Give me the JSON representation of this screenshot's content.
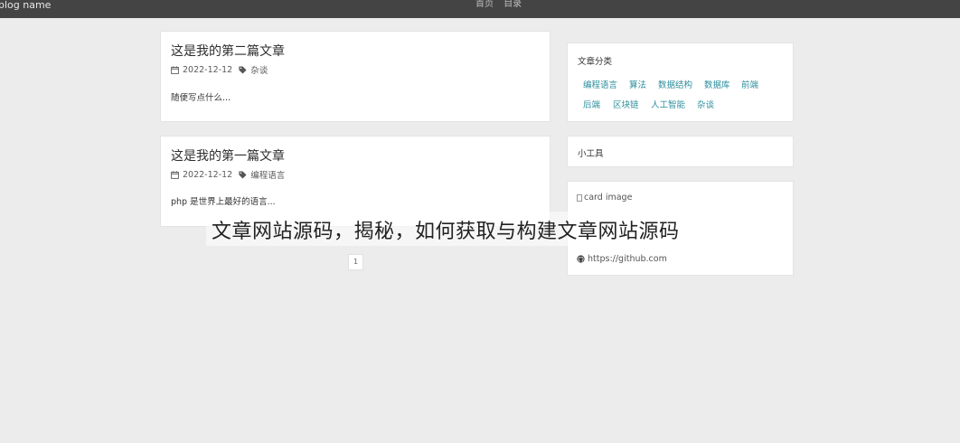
{
  "header": {
    "brand": "blog name",
    "nav": [
      "首页",
      "目录"
    ]
  },
  "posts": [
    {
      "title": "这是我的第二篇文章",
      "date": "2022-12-12",
      "tag": "杂谈",
      "excerpt": "随便写点什么..."
    },
    {
      "title": "这是我的第一篇文章",
      "date": "2022-12-12",
      "tag": "编程语言",
      "excerpt": "php 是世界上最好的语言..."
    }
  ],
  "sidebar": {
    "categories_title": "文章分类",
    "categories": [
      "编程语言",
      "算法",
      "数据结构",
      "数据库",
      "前端",
      "后端",
      "区块链",
      "人工智能",
      "杂谈"
    ],
    "tools_title": "小工具",
    "card_image_alt": "card image",
    "github_link": "https://github.com"
  },
  "overlay_caption": "文章网站源码，揭秘，如何获取与构建文章网站源码",
  "pagination": {
    "current": "1"
  }
}
